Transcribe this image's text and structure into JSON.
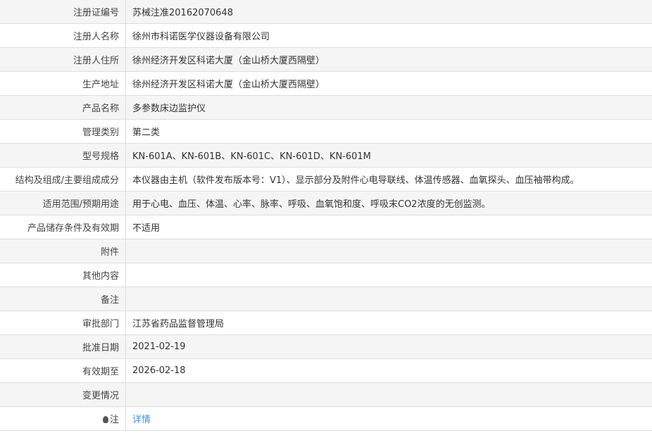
{
  "rows": [
    {
      "label": "注册证编号",
      "value": "苏械注准20162070648"
    },
    {
      "label": "注册人名称",
      "value": "徐州市科诺医学仪器设备有限公司"
    },
    {
      "label": "注册人住所",
      "value": "徐州经济开发区科诺大厦（金山桥大厦西隔壁）"
    },
    {
      "label": "生产地址",
      "value": "徐州经济开发区科诺大厦（金山桥大厦西隔壁）"
    },
    {
      "label": "产品名称",
      "value": "多参数床边监护仪"
    },
    {
      "label": "管理类别",
      "value": "第二类"
    },
    {
      "label": "型号规格",
      "value": "KN-601A、KN-601B、KN-601C、KN-601D、KN-601M"
    },
    {
      "label": "结构及组成/主要组成成分",
      "value": "本仪器由主机（软件发布版本号：V1）、显示部分及附件心电导联线、体温传感器、血氧探头、血压袖带构成。"
    },
    {
      "label": "适用范围/预期用途",
      "value": "用于心电、血压、体温、心率、脉率、呼吸、血氧饱和度、呼吸末CO2浓度的无创监测。"
    },
    {
      "label": "产品储存条件及有效期",
      "value": "不适用"
    },
    {
      "label": "附件",
      "value": ""
    },
    {
      "label": "其他内容",
      "value": ""
    },
    {
      "label": "备注",
      "value": ""
    },
    {
      "label": "审批部门",
      "value": "江苏省药品监督管理局"
    },
    {
      "label": "批准日期",
      "value": "2021-02-19"
    },
    {
      "label": "有效期至",
      "value": "2026-02-18"
    },
    {
      "label": "变更情况",
      "value": ""
    }
  ],
  "note": {
    "label": "注",
    "link": "详情"
  }
}
